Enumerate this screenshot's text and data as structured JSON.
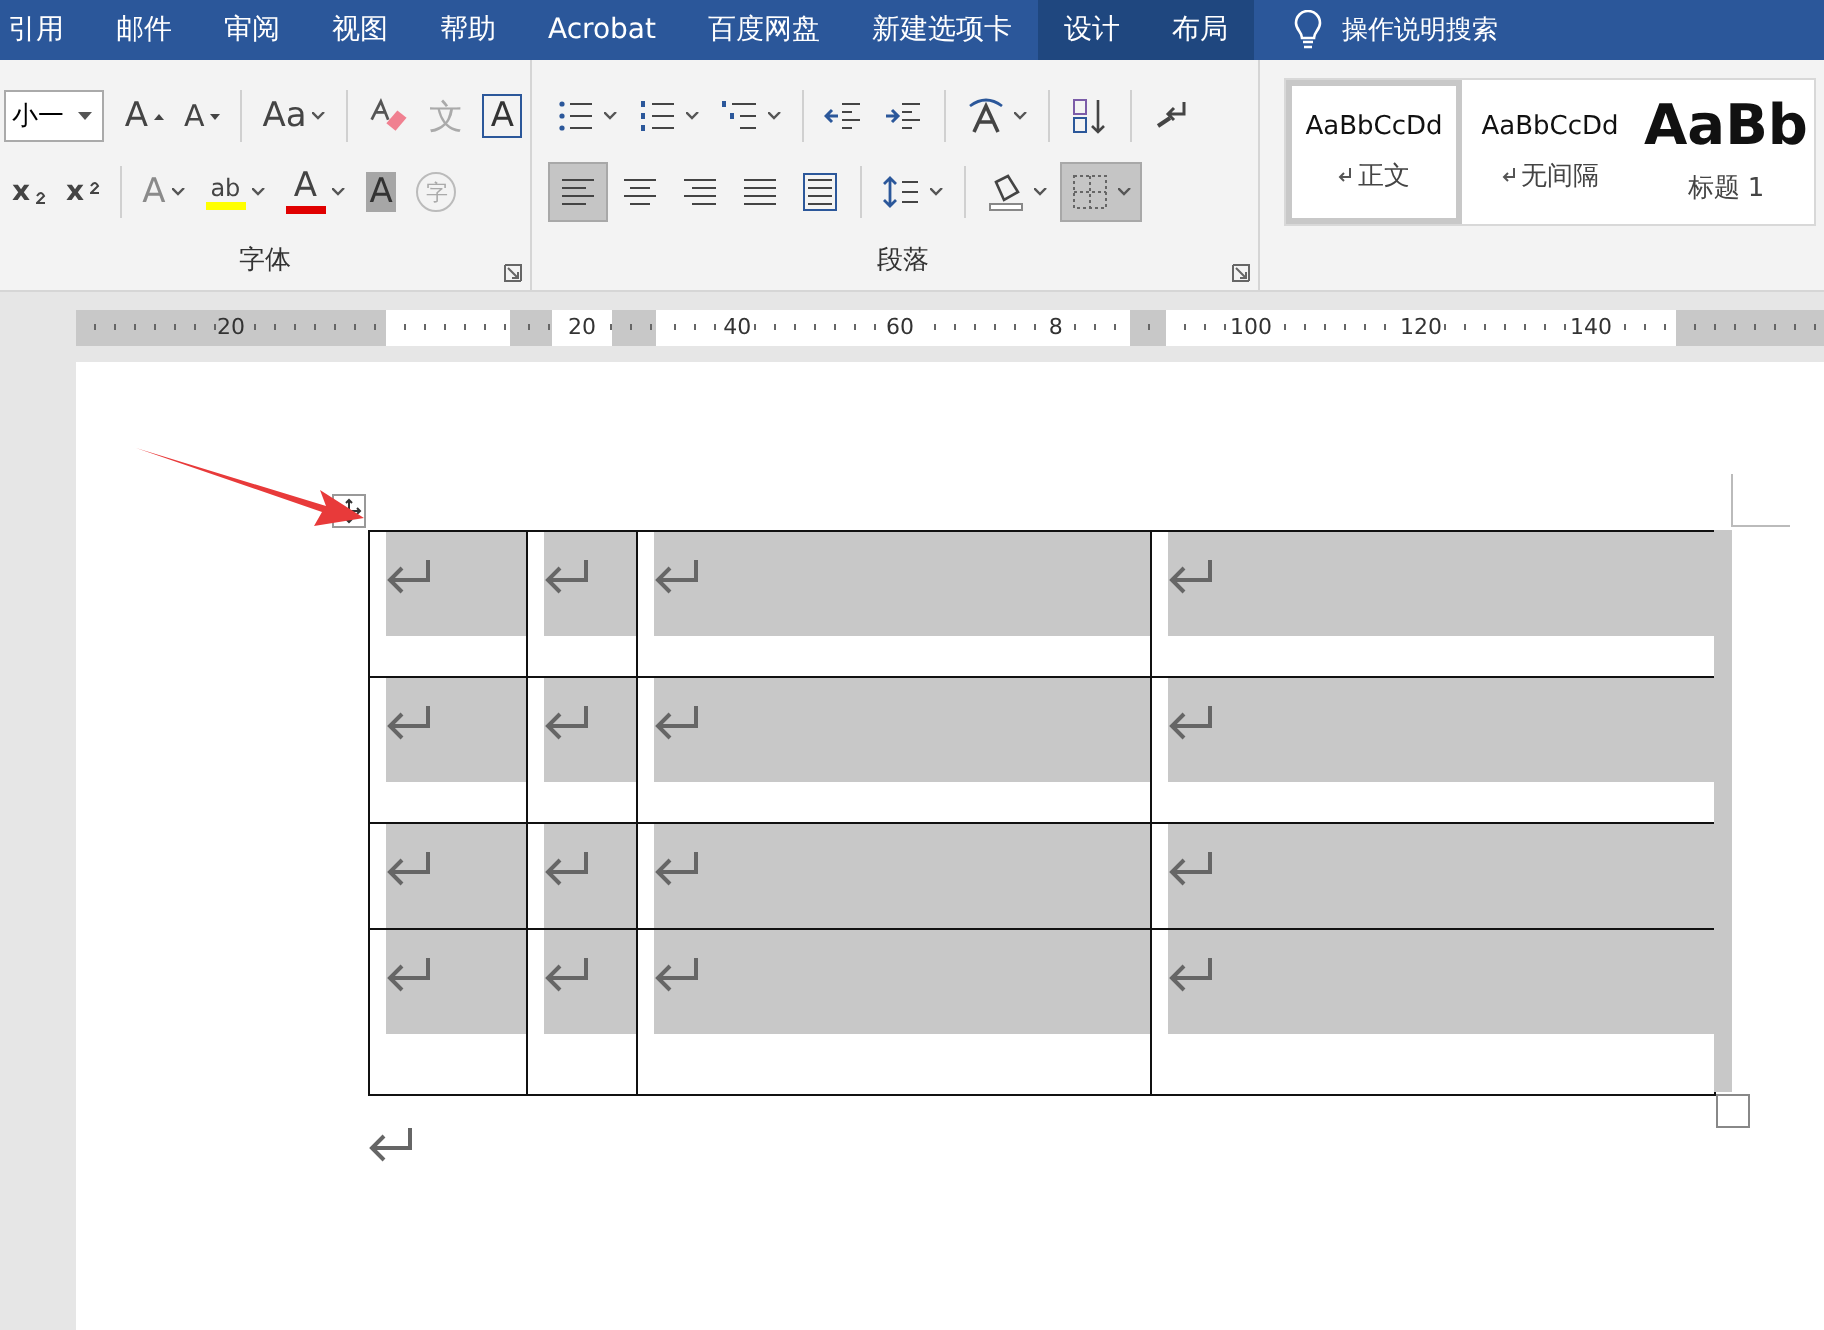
{
  "menu_tabs": [
    {
      "label": "引用",
      "contextual": false
    },
    {
      "label": "邮件",
      "contextual": false
    },
    {
      "label": "审阅",
      "contextual": false
    },
    {
      "label": "视图",
      "contextual": false
    },
    {
      "label": "帮助",
      "contextual": false
    },
    {
      "label": "Acrobat",
      "contextual": false
    },
    {
      "label": "百度网盘",
      "contextual": false
    },
    {
      "label": "新建选项卡",
      "contextual": false
    },
    {
      "label": "设计",
      "contextual": true
    },
    {
      "label": "布局",
      "contextual": true
    }
  ],
  "tell_me": {
    "label": "操作说明搜索"
  },
  "font_group": {
    "label": "字体",
    "font_size": "小一",
    "row1": [
      {
        "kind": "grow",
        "glyph": "A"
      },
      {
        "kind": "shrink",
        "glyph": "A"
      },
      {
        "kind": "case",
        "glyph": "Aa"
      },
      {
        "kind": "clear"
      },
      {
        "kind": "phonetic",
        "glyph": "文"
      },
      {
        "kind": "border",
        "glyph": "A"
      }
    ],
    "row2": [
      {
        "kind": "subscript",
        "glyph": "x"
      },
      {
        "kind": "superscript",
        "glyph": "x"
      },
      {
        "kind": "effects",
        "glyph": "A"
      },
      {
        "kind": "highlight",
        "glyph": "ab",
        "color": "#ffff00"
      },
      {
        "kind": "color",
        "glyph": "A",
        "color": "#e00000"
      },
      {
        "kind": "shading",
        "glyph": "A"
      },
      {
        "kind": "enclose",
        "glyph": "字"
      }
    ]
  },
  "paragraph_group": {
    "label": "段落",
    "row1": [
      {
        "kind": "bullets"
      },
      {
        "kind": "numbering"
      },
      {
        "kind": "multilevel"
      },
      {
        "kind": "outdent"
      },
      {
        "kind": "indent"
      },
      {
        "kind": "asian"
      },
      {
        "kind": "sort"
      },
      {
        "kind": "marks"
      }
    ],
    "row2": [
      {
        "kind": "align-left",
        "selected": true
      },
      {
        "kind": "align-center",
        "selected": false
      },
      {
        "kind": "align-right",
        "selected": false
      },
      {
        "kind": "justify",
        "selected": false
      },
      {
        "kind": "distribute",
        "selected": false
      },
      {
        "kind": "spacing",
        "selected": false
      },
      {
        "kind": "fill",
        "selected": false
      },
      {
        "kind": "borders",
        "selected": true
      }
    ]
  },
  "styles": [
    {
      "sample": "AaBbCcDd",
      "name": "正文",
      "kind": "body",
      "selected": true
    },
    {
      "sample": "AaBbCcDd",
      "name": "无间隔",
      "kind": "body",
      "selected": false
    },
    {
      "sample": "AaBb",
      "name": "标题 1",
      "kind": "heading",
      "selected": false
    }
  ],
  "ruler": {
    "segments": [
      {
        "kind": "margin",
        "labels": [
          "20"
        ]
      },
      {
        "kind": "text"
      },
      {
        "kind": "margin"
      },
      {
        "kind": "text",
        "labels": [
          "20"
        ]
      },
      {
        "kind": "margin"
      },
      {
        "kind": "text",
        "labels": [
          "40",
          "60",
          "8"
        ]
      },
      {
        "kind": "margin"
      },
      {
        "kind": "text",
        "labels": [
          "100",
          "120",
          "140"
        ]
      },
      {
        "kind": "margin"
      }
    ]
  },
  "table": {
    "rows": [
      {
        "cells": [
          {
            "selected": true
          },
          {
            "selected": true
          },
          {
            "selected": true
          },
          {
            "selected": true
          }
        ]
      },
      {
        "cells": [
          {
            "selected": true
          },
          {
            "selected": true
          },
          {
            "selected": true
          },
          {
            "selected": true
          }
        ]
      },
      {
        "cells": [
          {
            "selected": true
          },
          {
            "selected": true
          },
          {
            "selected": true
          },
          {
            "selected": true
          }
        ]
      },
      {
        "cells": [
          {
            "selected": true
          },
          {
            "selected": true
          },
          {
            "selected": true
          },
          {
            "selected": true
          }
        ]
      }
    ]
  }
}
